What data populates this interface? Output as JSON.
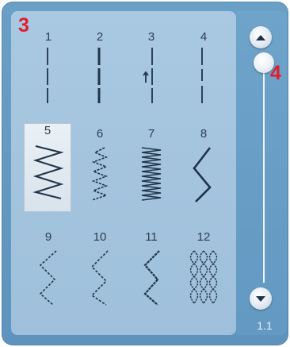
{
  "callouts": {
    "left": "3",
    "right": "4"
  },
  "stitches": [
    {
      "number": "1",
      "pattern": "straight-left-icon",
      "selected": false
    },
    {
      "number": "2",
      "pattern": "triple-straight-icon",
      "selected": false
    },
    {
      "number": "3",
      "pattern": "reverse-straight-icon",
      "selected": false
    },
    {
      "number": "4",
      "pattern": "basting-icon",
      "selected": false
    },
    {
      "number": "5",
      "pattern": "zigzag-wide-icon",
      "selected": true
    },
    {
      "number": "6",
      "pattern": "zigzag-stretch-icon",
      "selected": false
    },
    {
      "number": "7",
      "pattern": "satin-zigzag-icon",
      "selected": false
    },
    {
      "number": "8",
      "pattern": "three-step-zigzag-icon",
      "selected": false
    },
    {
      "number": "9",
      "pattern": "dotted-zigzag-icon",
      "selected": false
    },
    {
      "number": "10",
      "pattern": "dotted-zigzag-2-icon",
      "selected": false
    },
    {
      "number": "11",
      "pattern": "serpentine-icon",
      "selected": false
    },
    {
      "number": "12",
      "pattern": "honeycomb-icon",
      "selected": false
    }
  ],
  "scrollbar": {
    "up_icon": "chevron-up-icon",
    "down_icon": "chevron-down-icon",
    "page_label": "1.1",
    "position_fraction": 0
  },
  "colors": {
    "stitch": "#1f3348",
    "callout": "#e01e2e"
  }
}
